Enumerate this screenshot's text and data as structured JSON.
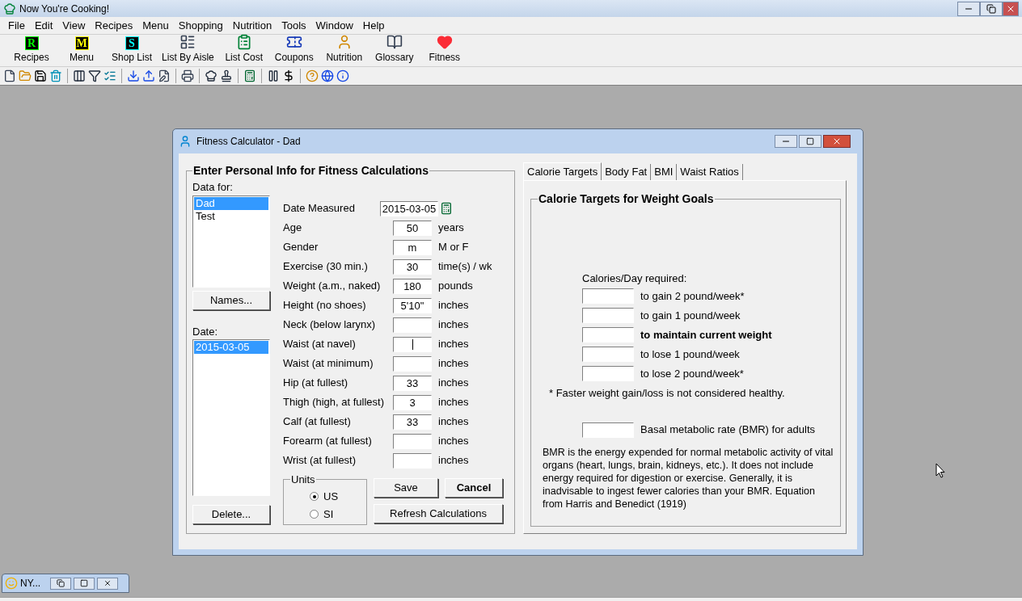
{
  "app_title": "Now You're Cooking!",
  "menu": [
    "File",
    "Edit",
    "View",
    "Recipes",
    "Menu",
    "Shopping",
    "Nutrition",
    "Tools",
    "Window",
    "Help"
  ],
  "big_toolbar": [
    {
      "label": "Recipes",
      "kind": "letter",
      "glyph": "R",
      "color": "#00ff00"
    },
    {
      "label": "Menu",
      "kind": "letter",
      "glyph": "M",
      "color": "#ffff00"
    },
    {
      "label": "Shop List",
      "kind": "letter",
      "glyph": "S",
      "color": "#00ffff"
    },
    {
      "label": "List By Aisle",
      "kind": "icon"
    },
    {
      "label": "List Cost",
      "kind": "icon"
    },
    {
      "label": "Coupons",
      "kind": "icon"
    },
    {
      "label": "Nutrition",
      "kind": "icon"
    },
    {
      "label": "Glossary",
      "kind": "icon"
    },
    {
      "label": "Fitness",
      "kind": "icon"
    }
  ],
  "dialog": {
    "title": "Fitness Calculator - Dad",
    "group_title": "Enter Personal Info for Fitness Calculations",
    "data_for_label": "Data for:",
    "people": [
      {
        "name": "Dad",
        "selected": true
      },
      {
        "name": "Test",
        "selected": false
      }
    ],
    "names_button": "Names...",
    "date_label": "Date:",
    "dates": [
      {
        "text": "2015-03-05",
        "selected": true
      }
    ],
    "delete_button": "Delete...",
    "date_measured": {
      "label": "Date Measured",
      "value": "2015-03-05"
    },
    "fields": [
      {
        "label": "Age",
        "value": "50",
        "unit": "years",
        "focused": false
      },
      {
        "label": "Gender",
        "value": "m",
        "unit": "M or F",
        "focused": false
      },
      {
        "label": "Exercise (30 min.)",
        "value": "30",
        "unit": "time(s) / wk",
        "focused": false
      },
      {
        "label": "Weight (a.m., naked)",
        "value": "180",
        "unit": "pounds",
        "focused": false
      },
      {
        "label": "Height (no shoes)",
        "value": "5'10\"",
        "unit": "inches",
        "focused": false
      },
      {
        "label": "Neck (below larynx)",
        "unit": "inches",
        "focused": false
      },
      {
        "label": "Waist (at navel)",
        "unit": "inches",
        "focused": true
      },
      {
        "label": "Waist (at minimum)",
        "unit": "inches",
        "focused": false
      },
      {
        "label": "Hip (at fullest)",
        "value": "33",
        "unit": "inches",
        "focused": false
      },
      {
        "label": "Thigh (high, at fullest)",
        "value": "3",
        "unit": "inches",
        "focused": false
      },
      {
        "label": "Calf (at fullest)",
        "value": "33",
        "unit": "inches",
        "focused": false
      },
      {
        "label": "Forearm (at fullest)",
        "unit": "inches",
        "focused": false
      },
      {
        "label": "Wrist (at fullest)",
        "unit": "inches",
        "focused": false
      }
    ],
    "units": {
      "label": "Units",
      "options": [
        {
          "label": "US",
          "selected": true
        },
        {
          "label": "SI",
          "selected": false
        }
      ]
    },
    "save_button": "Save",
    "cancel_button": "Cancel",
    "refresh_button": "Refresh Calculations",
    "tabs": [
      {
        "label": "Calorie Targets",
        "selected": true
      },
      {
        "label": "Body Fat",
        "selected": false
      },
      {
        "label": "BMI",
        "selected": false
      },
      {
        "label": "Waist Ratios",
        "selected": false
      }
    ],
    "calorie_group_title": "Calorie Targets for Weight Goals",
    "calories_label": "Calories/Day required:",
    "targets": [
      {
        "label": "to gain 2 pound/week*",
        "bold": false
      },
      {
        "label": "to gain 1 pound/week",
        "bold": false
      },
      {
        "label": "to maintain current weight",
        "bold": true
      },
      {
        "label": "to lose 1 pound/week",
        "bold": false
      },
      {
        "label": "to lose 2 pound/week*",
        "bold": false
      }
    ],
    "footnote": "* Faster weight gain/loss is not considered healthy.",
    "bmr_label": "Basal metabolic rate (BMR) for adults",
    "bmr_note": "BMR is the energy expended for normal metabolic activity of vital organs (heart, lungs, brain, kidneys, etc.).  It does not include energy required for digestion or exercise. Generally, it is inadvisable to ingest fewer calories than your BMR. Equation from Harris and Benedict (1919)"
  },
  "minimized": {
    "title": "NY..."
  }
}
